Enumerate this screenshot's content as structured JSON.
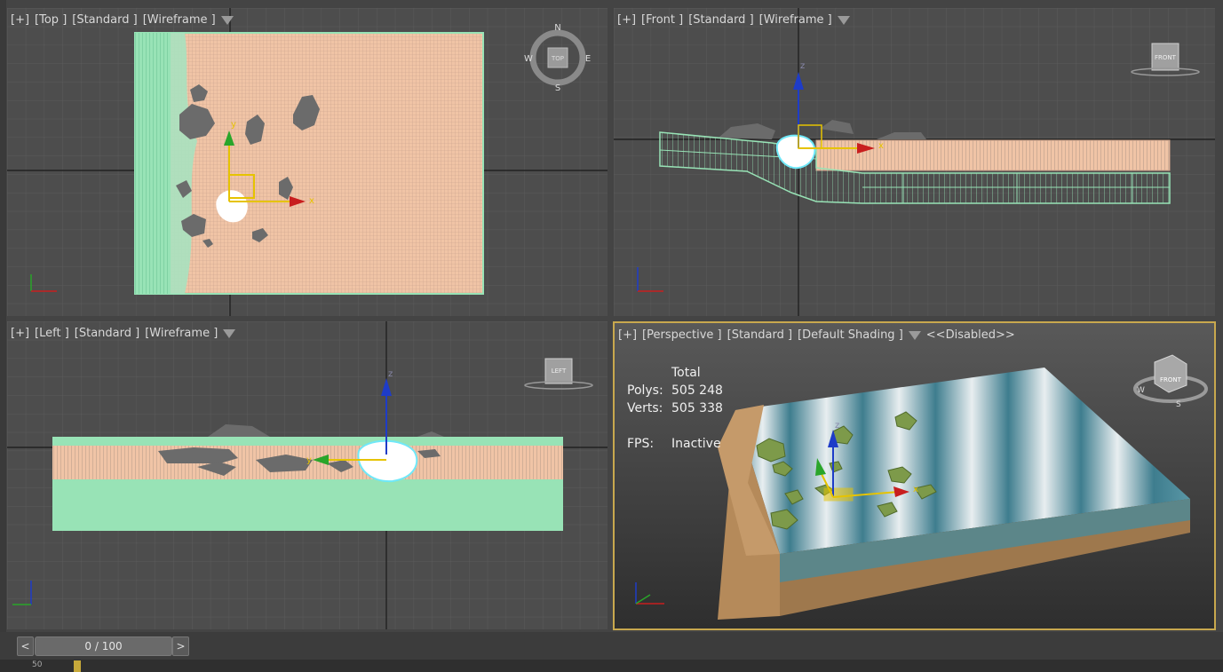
{
  "viewports": {
    "top": {
      "labels": [
        "[+]",
        "[Top ]",
        "[Standard ]",
        "[Wireframe ]"
      ],
      "compass": {
        "n": "N",
        "s": "S",
        "e": "E",
        "w": "W",
        "center": "TOP"
      },
      "active": false
    },
    "front": {
      "labels": [
        "[+]",
        "[Front ]",
        "[Standard ]",
        "[Wireframe ]"
      ],
      "cube": "FRONT",
      "active": false
    },
    "left": {
      "labels": [
        "[+]",
        "[Left ]",
        "[Standard ]",
        "[Wireframe ]"
      ],
      "cube": "LEFT",
      "active": false
    },
    "perspective": {
      "labels": [
        "[+]",
        "[Perspective ]",
        "[Standard ]",
        "[Default Shading ]"
      ],
      "extra": "<<Disabled>>",
      "cube": "FRONT",
      "stats": {
        "header": "Total",
        "polys_label": "Polys:",
        "polys": "505 248",
        "verts_label": "Verts:",
        "verts": "505 338",
        "fps_label": "FPS:",
        "fps": "Inactive"
      },
      "compass": {
        "w": "W",
        "s": "S"
      },
      "active": true
    }
  },
  "axes": {
    "x": "x",
    "y": "y",
    "z": "z"
  },
  "timeline": {
    "prev": "<",
    "next": ">",
    "frame": "0 / 100",
    "track_label": "50"
  },
  "colors": {
    "viewport_bg": "#4d4d4d",
    "active_border": "#c8a84e",
    "wire_mesh": "#98e3b6",
    "sand_wire": "#f0c4a6",
    "rock": "#6b6b6b",
    "gizmo_x": "#c81e1e",
    "gizmo_y": "#2aa52a",
    "gizmo_z": "#1e3cc8",
    "gizmo_plane": "#e6c300",
    "sand": "#b58a5a",
    "water": "#3e7d8e",
    "foam": "#e8eef0"
  }
}
